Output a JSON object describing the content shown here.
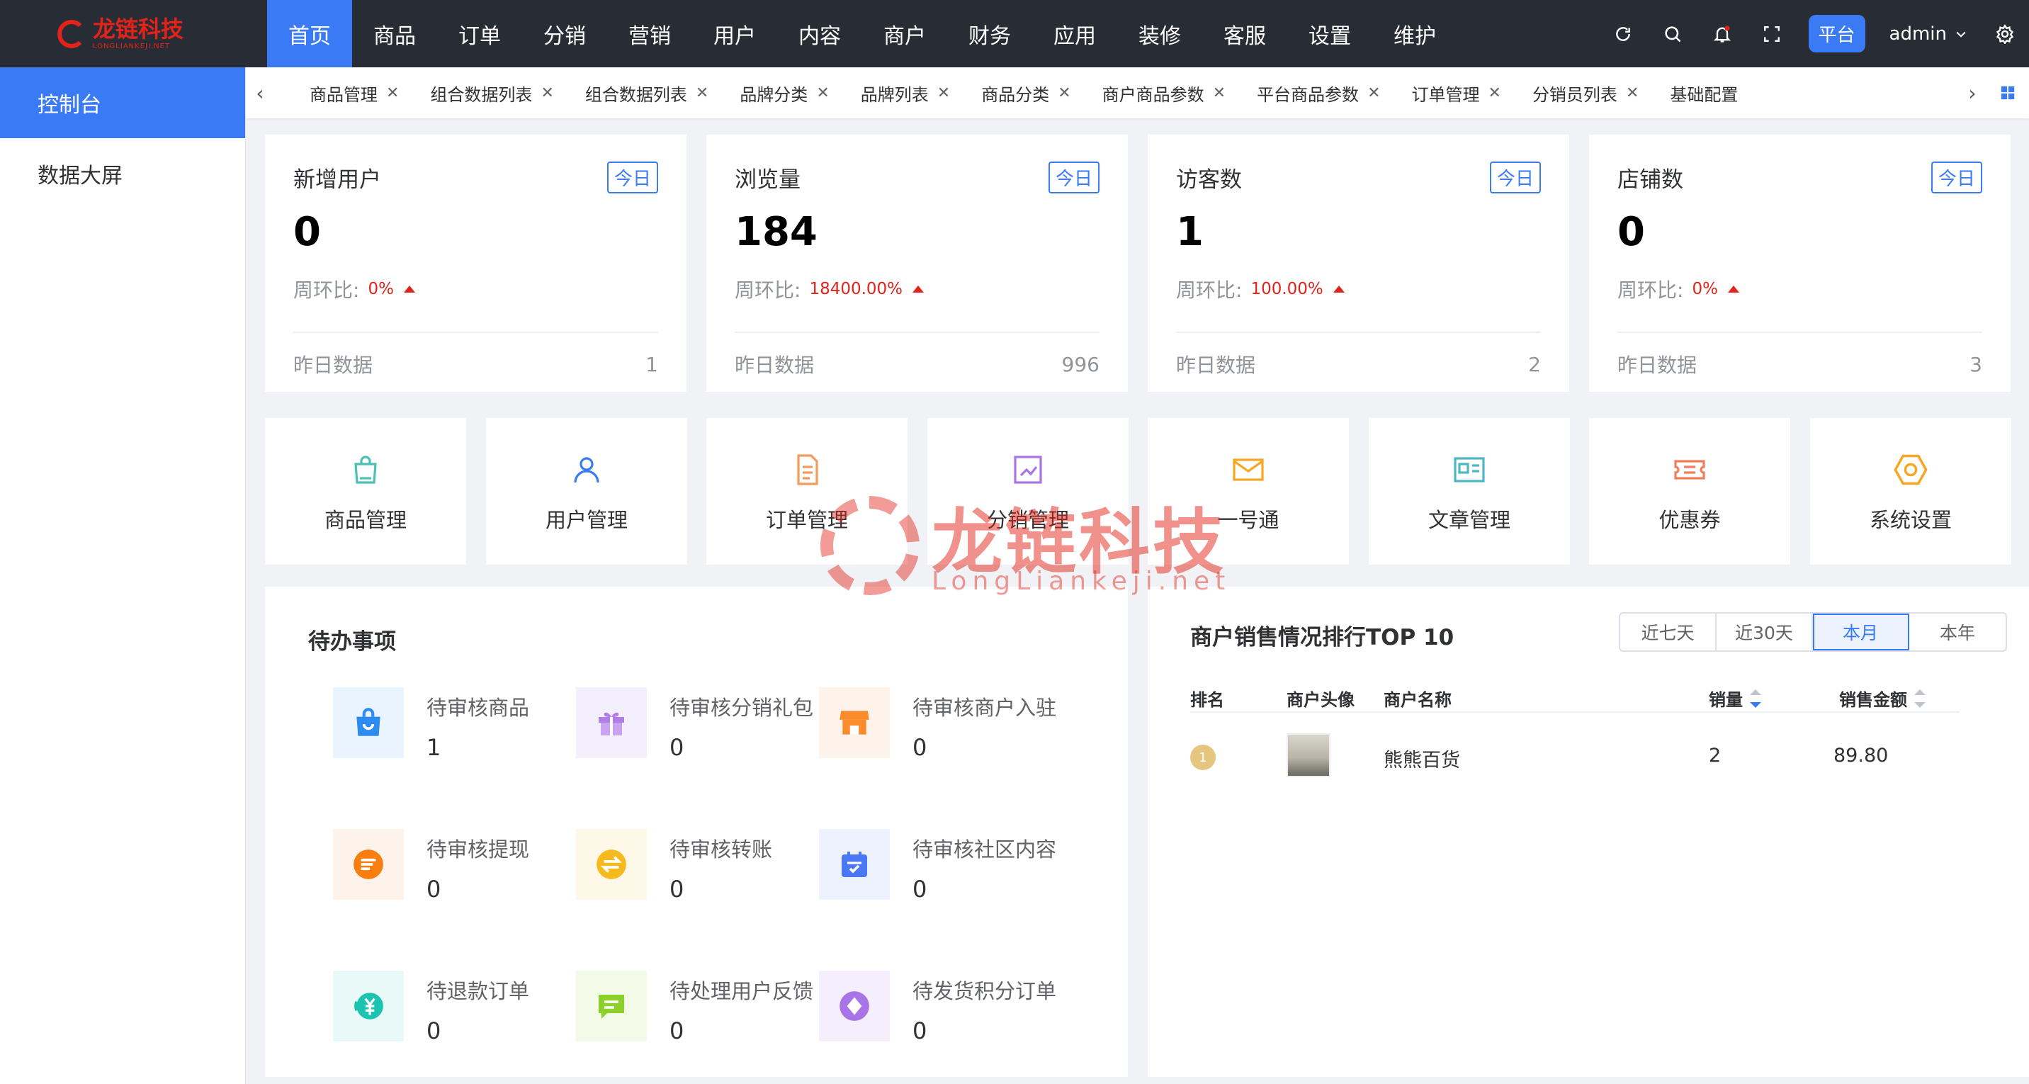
{
  "brand": {
    "name_cn": "龙链科技",
    "name_en": "LONGLIANKEJI.NET"
  },
  "nav": [
    "首页",
    "商品",
    "订单",
    "分销",
    "营销",
    "用户",
    "内容",
    "商户",
    "财务",
    "应用",
    "装修",
    "客服",
    "设置",
    "维护"
  ],
  "header": {
    "platform_label": "平台",
    "user": "admin"
  },
  "sidebar": [
    "控制台",
    "数据大屏"
  ],
  "tabs": [
    "商品管理",
    "组合数据列表",
    "组合数据列表",
    "品牌分类",
    "品牌列表",
    "商品分类",
    "商户商品参数",
    "平台商品参数",
    "订单管理",
    "分销员列表",
    "基础配置"
  ],
  "stats": [
    {
      "title": "新增用户",
      "badge": "今日",
      "value": "0",
      "ratio_label": "周环比:",
      "ratio": "0%",
      "foot_label": "昨日数据",
      "foot_value": "1"
    },
    {
      "title": "浏览量",
      "badge": "今日",
      "value": "184",
      "ratio_label": "周环比:",
      "ratio": "18400.00%",
      "foot_label": "昨日数据",
      "foot_value": "996"
    },
    {
      "title": "访客数",
      "badge": "今日",
      "value": "1",
      "ratio_label": "周环比:",
      "ratio": "100.00%",
      "foot_label": "昨日数据",
      "foot_value": "2"
    },
    {
      "title": "店铺数",
      "badge": "今日",
      "value": "0",
      "ratio_label": "周环比:",
      "ratio": "0%",
      "foot_label": "昨日数据",
      "foot_value": "3"
    }
  ],
  "quick": [
    {
      "label": "商品管理",
      "icon": "shopping-bag-icon",
      "color": "#4cc0b5"
    },
    {
      "label": "用户管理",
      "icon": "user-icon",
      "color": "#3a7bf5"
    },
    {
      "label": "订单管理",
      "icon": "document-icon",
      "color": "#f29b5b"
    },
    {
      "label": "分销管理",
      "icon": "trend-chart-icon",
      "color": "#a974e5"
    },
    {
      "label": "一号通",
      "icon": "envelope-icon",
      "color": "#f5a623"
    },
    {
      "label": "文章管理",
      "icon": "article-card-icon",
      "color": "#4cb8c4"
    },
    {
      "label": "优惠券",
      "icon": "coupon-icon",
      "color": "#f07d5b"
    },
    {
      "label": "系统设置",
      "icon": "hexagon-settings-icon",
      "color": "#f5a623"
    }
  ],
  "todo": {
    "title": "待办事项",
    "items": [
      {
        "name": "待审核商品",
        "num": "1",
        "icon": "shopping-bag-icon",
        "color": "#2e8cf0",
        "bg": "#eaf4fe"
      },
      {
        "name": "待审核分销礼包",
        "num": "0",
        "icon": "gift-icon",
        "color": "#b07ee8",
        "bg": "#f4effd"
      },
      {
        "name": "待审核商户入驻",
        "num": "0",
        "icon": "store-icon",
        "color": "#fb8c2c",
        "bg": "#fef3ea"
      },
      {
        "name": "待审核提现",
        "num": "0",
        "icon": "withdraw-icon",
        "color": "#fa7d0f",
        "bg": "#fef3ea"
      },
      {
        "name": "待审核转账",
        "num": "0",
        "icon": "transfer-icon",
        "color": "#f7ba1e",
        "bg": "#fef8e8"
      },
      {
        "name": "待审核社区内容",
        "num": "0",
        "icon": "calendar-check-icon",
        "color": "#4a78f2",
        "bg": "#edf2fe"
      },
      {
        "name": "待退款订单",
        "num": "0",
        "icon": "refund-yen-icon",
        "color": "#1bc4b0",
        "bg": "#e8f9f7"
      },
      {
        "name": "待处理用户反馈",
        "num": "0",
        "icon": "feedback-icon",
        "color": "#8bd12a",
        "bg": "#f3fbe8"
      },
      {
        "name": "待发货积分订单",
        "num": "0",
        "icon": "diamond-icon",
        "color": "#a874e8",
        "bg": "#f5effd"
      }
    ]
  },
  "ranking": {
    "title": "商户销售情况排行TOP 10",
    "ranges": [
      "近七天",
      "近30天",
      "本月",
      "本年"
    ],
    "active_range": "本月",
    "columns": [
      "排名",
      "商户头像",
      "商户名称",
      "销量",
      "销售金额"
    ],
    "rows": [
      {
        "rank": "1",
        "name": "熊熊百货",
        "sales": "2",
        "amount": "89.80"
      }
    ]
  },
  "watermark": {
    "cn": "龙链科技",
    "en": "LongLiankeji.net"
  },
  "colors": {
    "accent": "#3a7bf5",
    "topbar": "#282c34",
    "up": "#e2231a"
  }
}
